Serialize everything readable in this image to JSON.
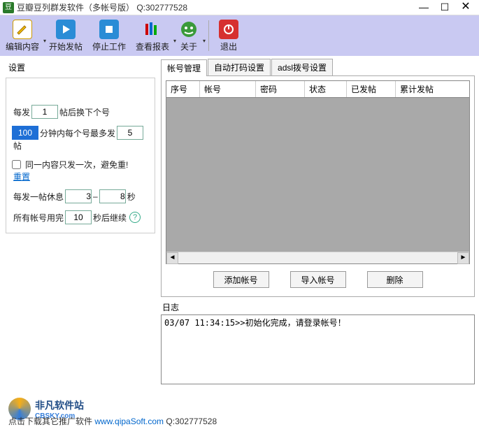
{
  "window": {
    "icon_letter": "豆",
    "title": "豆瓣豆列群发软件（多帐号版）   Q:302777528",
    "min": "—",
    "max": "☐",
    "close": "✕"
  },
  "toolbar": {
    "edit": "编辑内容",
    "start": "开始发帖",
    "stop": "停止工作",
    "report": "查看报表",
    "about": "关于",
    "exit": "退出"
  },
  "settings": {
    "title": "设置",
    "row1_pre": "每发",
    "row1_val": "1",
    "row1_post": "帖后换下个号",
    "row2_val1": "100",
    "row2_mid1": "分钟内每个号最多发",
    "row2_val2": "5",
    "row2_post": "帖",
    "row3_chk": "同一内容只发一次，避免重!",
    "row3_link": "重置",
    "row4_pre": "每发一帖休息",
    "row4_val1": "3",
    "row4_sep": "–",
    "row4_val2": "8",
    "row4_post": "秒",
    "row5_pre": "所有帐号用完",
    "row5_val": "10",
    "row5_post": "秒后继续",
    "help": "?"
  },
  "tabs": {
    "t1": "帐号管理",
    "t2": "自动打码设置",
    "t3": "adsl拨号设置"
  },
  "table": {
    "headers": [
      "序号",
      "帐号",
      "密码",
      "状态",
      "已发帖",
      "累计发帖"
    ],
    "widths": [
      48,
      80,
      70,
      60,
      70,
      80
    ]
  },
  "buttons": {
    "add": "添加帐号",
    "import": "导入帐号",
    "del": "删除"
  },
  "log": {
    "title": "日志",
    "line1": "03/07 11:34:15>>初始化完成，请登录帐号！"
  },
  "watermark": {
    "text": "非凡软件站",
    "sub": "CBSKY.com"
  },
  "footer": {
    "pre": "点击下载其它推广软件 ",
    "url": "www.qipaSoft.com",
    "post": " Q:302777528"
  },
  "scroll": {
    "left": "◄",
    "right": "►"
  }
}
